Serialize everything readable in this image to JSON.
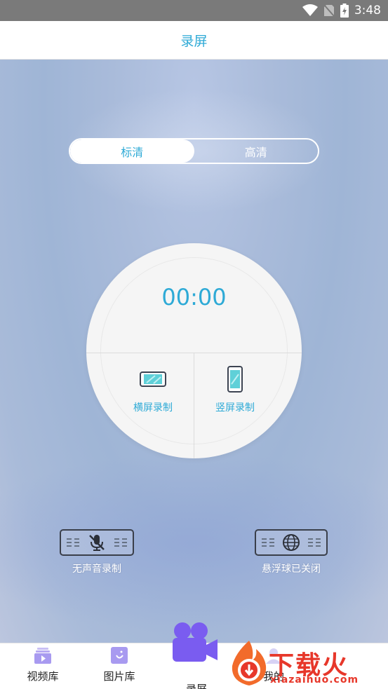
{
  "status_bar": {
    "time": "3:48"
  },
  "header": {
    "title": "录屏"
  },
  "quality": {
    "options": [
      "标清",
      "高清"
    ],
    "selected": "标清"
  },
  "recorder": {
    "timer": "00:00",
    "landscape_label": "横屏录制",
    "portrait_label": "竖屏录制"
  },
  "options": {
    "mute_label": "无声音录制",
    "floating_ball_label": "悬浮球已关闭"
  },
  "nav": {
    "items": [
      {
        "label": "视频库",
        "icon": "video-library-icon"
      },
      {
        "label": "图片库",
        "icon": "image-library-icon"
      },
      {
        "label": "录屏",
        "icon": "camera-icon"
      },
      {
        "label": "我的",
        "icon": "profile-icon"
      }
    ]
  },
  "watermark": {
    "text": "下载火",
    "url": "xiazaihuo.com"
  },
  "colors": {
    "accent": "#2eaad6",
    "fab": "#7a5cf0",
    "watermark": "#e7372a"
  }
}
